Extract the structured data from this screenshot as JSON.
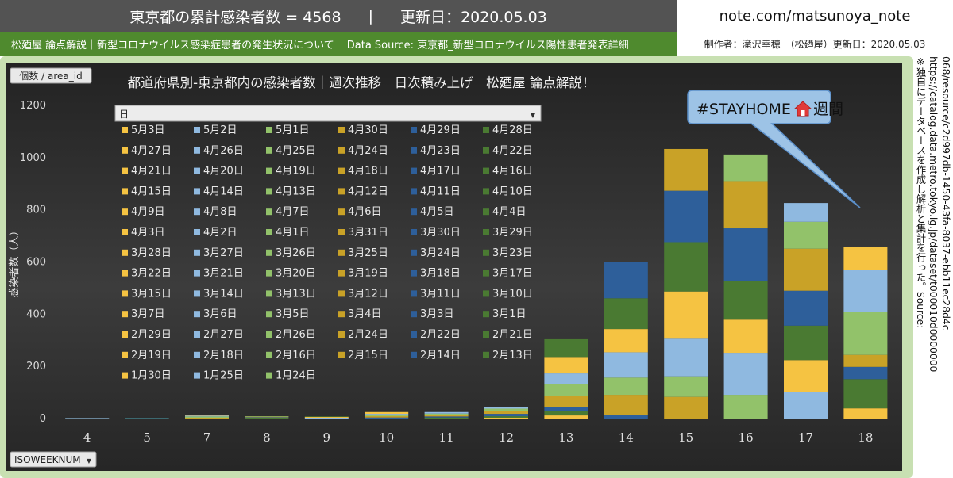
{
  "header": {
    "title": "東京都の累計感染者数 = 4568",
    "separator": "|",
    "updated": "更新日：2020.05.03",
    "subtitle": "松廼屋 論点解説｜新型コロナウイルス感染症患者の発生状況について",
    "datasource": "Data Source: 東京都_新型コロナウイルス陽性患者発表詳細",
    "site": "note.com/matsunoya_note",
    "author": "制作者：滝沢幸穂　（松廼屋）更新日：2020.05.03"
  },
  "side_note": [
    "※独自にデータベースを作成し解析と集計を行った。Source:",
    "https://catalog.data.metro.tokyo.lg.jp/dataset/t000010d0000000",
    "068/resource/c2d997db-1450-43fa-8037-ebb11ec28d4c"
  ],
  "filters": {
    "count_button": "個数 / area_id",
    "day_field": "日",
    "week_field": "ISOWEEKNUM"
  },
  "annotation": {
    "text": "#STAYHOME",
    "suffix": "週間",
    "icon": "house-icon"
  },
  "colors": {
    "yellow": "#f5c342",
    "light_blue": "#8fb9e0",
    "light_green": "#92c26a",
    "gold": "#c9a227",
    "dark_blue": "#2e5f9a",
    "dark_green": "#4a7a32",
    "bright_yellow": "#fcd65b",
    "blue": "#3f80c4",
    "green_light": "#a9d18e",
    "brown": "#9a7a1f",
    "orange_gold": "#e0a21a",
    "navy": "#1f4e79",
    "dark_olive": "#375623"
  },
  "chart_data": {
    "type": "bar",
    "stacked": true,
    "title": "都道府県別-東京都内の感染者数｜週次推移　日次積み上げ　松廼屋 論点解説！",
    "xlabel": "",
    "ylabel": "感染者数（人）",
    "ylim": [
      0,
      1200
    ],
    "yticks": [
      0,
      200,
      400,
      600,
      800,
      1000,
      1200
    ],
    "categories": [
      "4",
      "5",
      "7",
      "8",
      "9",
      "10",
      "11",
      "12",
      "13",
      "14",
      "15",
      "16",
      "17",
      "18"
    ],
    "totals": [
      2,
      3,
      14,
      9,
      8,
      25,
      25,
      45,
      290,
      600,
      1033,
      1012,
      826,
      659
    ],
    "stacks": [
      [
        {
          "day": "1月24日",
          "value": 1
        },
        {
          "day": "1月25日",
          "value": 1
        }
      ],
      [
        {
          "day": "1月30日",
          "value": 1
        },
        {
          "day": "2月13日",
          "value": 1
        },
        {
          "day": "2月14日",
          "value": 1
        }
      ],
      [
        {
          "day": "2月15日",
          "value": 3
        },
        {
          "day": "2月16日",
          "value": 5
        },
        {
          "day": "2月18日",
          "value": 3
        },
        {
          "day": "2月19日",
          "value": 3
        }
      ],
      [
        {
          "day": "2月21日",
          "value": 3
        },
        {
          "day": "2月22日",
          "value": 2
        },
        {
          "day": "2月24日",
          "value": 2
        },
        {
          "day": "2月26日",
          "value": 2
        }
      ],
      [
        {
          "day": "2月27日",
          "value": 3
        },
        {
          "day": "2月29日",
          "value": 3
        },
        {
          "day": "3月1日",
          "value": 2
        }
      ],
      [
        {
          "day": "3月3日",
          "value": 4
        },
        {
          "day": "3月4日",
          "value": 5
        },
        {
          "day": "3月5日",
          "value": 4
        },
        {
          "day": "3月6日",
          "value": 5
        },
        {
          "day": "3月7日",
          "value": 7
        }
      ],
      [
        {
          "day": "3月10日",
          "value": 4
        },
        {
          "day": "3月11日",
          "value": 4
        },
        {
          "day": "3月12日",
          "value": 6
        },
        {
          "day": "3月13日",
          "value": 5
        },
        {
          "day": "3月14日",
          "value": 6
        }
      ],
      [
        {
          "day": "3月15日",
          "value": 3
        },
        {
          "day": "3月17日",
          "value": 6
        },
        {
          "day": "3月18日",
          "value": 9
        },
        {
          "day": "3月19日",
          "value": 10
        },
        {
          "day": "3月20日",
          "value": 10
        },
        {
          "day": "3月21日",
          "value": 7
        }
      ],
      [
        {
          "day": "3月22日",
          "value": 12
        },
        {
          "day": "3月23日",
          "value": 16
        },
        {
          "day": "3月24日",
          "value": 17
        },
        {
          "day": "3月25日",
          "value": 41
        },
        {
          "day": "3月26日",
          "value": 47
        },
        {
          "day": "3月27日",
          "value": 40
        },
        {
          "day": "3月28日",
          "value": 63
        },
        {
          "day": "3月29日",
          "value": 68
        }
      ],
      [
        {
          "day": "3月30日",
          "value": 13
        },
        {
          "day": "3月31日",
          "value": 78
        },
        {
          "day": "4月1日",
          "value": 66
        },
        {
          "day": "4月2日",
          "value": 97
        },
        {
          "day": "4月3日",
          "value": 89
        },
        {
          "day": "4月4日",
          "value": 118
        },
        {
          "day": "4月5日",
          "value": 139
        }
      ],
      [
        {
          "day": "4月6日",
          "value": 83
        },
        {
          "day": "4月7日",
          "value": 79
        },
        {
          "day": "4月8日",
          "value": 144
        },
        {
          "day": "4月9日",
          "value": 181
        },
        {
          "day": "4月10日",
          "value": 189
        },
        {
          "day": "4月11日",
          "value": 197
        },
        {
          "day": "4月12日",
          "value": 160
        }
      ],
      [
        {
          "day": "4月13日",
          "value": 91
        },
        {
          "day": "4月14日",
          "value": 161
        },
        {
          "day": "4月15日",
          "value": 127
        },
        {
          "day": "4月16日",
          "value": 149
        },
        {
          "day": "4月17日",
          "value": 201
        },
        {
          "day": "4月18日",
          "value": 181
        },
        {
          "day": "4月19日",
          "value": 102
        }
      ],
      [
        {
          "day": "4月20日",
          "value": 101
        },
        {
          "day": "4月21日",
          "value": 123
        },
        {
          "day": "4月22日",
          "value": 132
        },
        {
          "day": "4月23日",
          "value": 134
        },
        {
          "day": "4月24日",
          "value": 161
        },
        {
          "day": "4月25日",
          "value": 103
        },
        {
          "day": "4月26日",
          "value": 72
        }
      ],
      [
        {
          "day": "4月27日",
          "value": 39
        },
        {
          "day": "4月28日",
          "value": 112
        },
        {
          "day": "4月29日",
          "value": 47
        },
        {
          "day": "4月30日",
          "value": 46
        },
        {
          "day": "5月1日",
          "value": 165
        },
        {
          "day": "5月2日",
          "value": 160
        },
        {
          "day": "5月3日",
          "value": 90
        }
      ]
    ],
    "legend_days": [
      "5月3日",
      "5月2日",
      "5月1日",
      "4月30日",
      "4月29日",
      "4月28日",
      "4月27日",
      "4月26日",
      "4月25日",
      "4月24日",
      "4月23日",
      "4月22日",
      "4月21日",
      "4月20日",
      "4月19日",
      "4月18日",
      "4月17日",
      "4月16日",
      "4月15日",
      "4月14日",
      "4月13日",
      "4月12日",
      "4月11日",
      "4月10日",
      "4月9日",
      "4月8日",
      "4月7日",
      "4月6日",
      "4月5日",
      "4月4日",
      "4月3日",
      "4月2日",
      "4月1日",
      "3月31日",
      "3月30日",
      "3月29日",
      "3月28日",
      "3月27日",
      "3月26日",
      "3月25日",
      "3月24日",
      "3月23日",
      "3月22日",
      "3月21日",
      "3月20日",
      "3月19日",
      "3月18日",
      "3月17日",
      "3月15日",
      "3月14日",
      "3月13日",
      "3月12日",
      "3月11日",
      "3月10日",
      "3月7日",
      "3月6日",
      "3月5日",
      "3月4日",
      "3月3日",
      "3月1日",
      "2月29日",
      "2月27日",
      "2月26日",
      "2月24日",
      "2月22日",
      "2月21日",
      "2月19日",
      "2月18日",
      "2月16日",
      "2月15日",
      "2月14日",
      "2月13日",
      "1月30日",
      "1月25日",
      "1月24日"
    ],
    "legend_colors": [
      "yellow",
      "light_blue",
      "light_green",
      "gold",
      "dark_blue",
      "dark_green"
    ],
    "grid": false,
    "legend_position": "top-left"
  }
}
